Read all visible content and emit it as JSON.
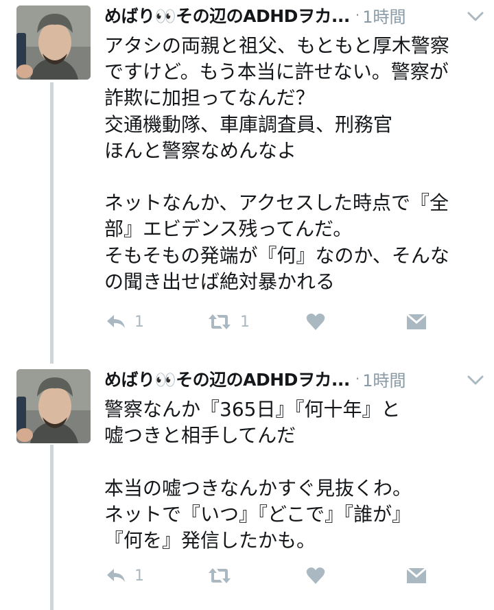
{
  "tweets": [
    {
      "author_name": "めばり👀その辺のADHDヲカ...",
      "time": "1時間",
      "text": "アタシの両親と祖父、もともと厚木警察\nですけど。もう本当に許せない。警察が\n詐欺に加担ってなんだ？\n交通機動隊、車庫調査員、刑務官\nほんと警察なめんなよ\n\nネットなんか、アクセスした時点で『全\n部』エビデンス残ってんだ。\nそもそもの発端が『何』なのか、そんな\nの聞き出せば絶対暴かれる",
      "reply_count": "1",
      "retweet_count": "1"
    },
    {
      "author_name": "めばり👀その辺のADHDヲカ...",
      "time": "1時間",
      "text": "警察なんか『365日』『何十年』と\n嘘つきと相手してんだ\n\n本当の嘘つきなんかすぐ見抜くわ。\nネットで『いつ』『どこで』『誰が』\n『何を』発信したかも。",
      "reply_count": "1",
      "retweet_count": ""
    }
  ],
  "icons": {
    "reply": "reply-icon",
    "retweet": "retweet-icon",
    "like": "heart-icon",
    "dm": "envelope-icon",
    "menu": "chevron-down-icon"
  },
  "colors": {
    "text": "#14171a",
    "muted": "#8899a6",
    "icon": "#aab8c2",
    "thread_line": "#ccd6dd"
  }
}
